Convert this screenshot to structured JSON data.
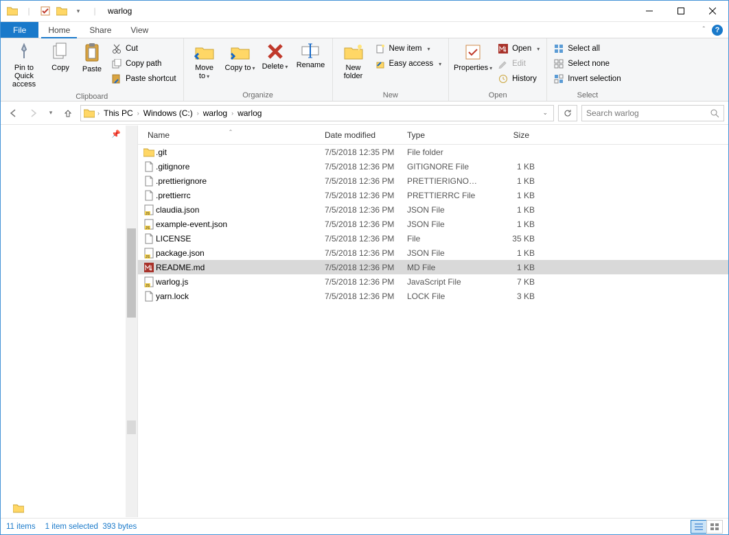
{
  "window": {
    "title": "warlog"
  },
  "tabs": {
    "file": "File",
    "home": "Home",
    "share": "Share",
    "view": "View"
  },
  "ribbon": {
    "clipboard": {
      "label": "Clipboard",
      "pin": "Pin to Quick access",
      "copy": "Copy",
      "paste": "Paste",
      "cut": "Cut",
      "copy_path": "Copy path",
      "paste_shortcut": "Paste shortcut"
    },
    "organize": {
      "label": "Organize",
      "move_to": "Move to",
      "copy_to": "Copy to",
      "delete": "Delete",
      "rename": "Rename"
    },
    "new": {
      "label": "New",
      "new_folder": "New folder",
      "new_item": "New item",
      "easy_access": "Easy access"
    },
    "open": {
      "label": "Open",
      "properties": "Properties",
      "open": "Open",
      "edit": "Edit",
      "history": "History"
    },
    "select": {
      "label": "Select",
      "select_all": "Select all",
      "select_none": "Select none",
      "invert": "Invert selection"
    }
  },
  "breadcrumb": [
    "This PC",
    "Windows (C:)",
    "warlog",
    "warlog"
  ],
  "search": {
    "placeholder": "Search warlog"
  },
  "columns": {
    "name": "Name",
    "date": "Date modified",
    "type": "Type",
    "size": "Size"
  },
  "files": [
    {
      "icon": "folder",
      "name": ".git",
      "date": "7/5/2018 12:35 PM",
      "type": "File folder",
      "size": "",
      "selected": false
    },
    {
      "icon": "file",
      "name": ".gitignore",
      "date": "7/5/2018 12:36 PM",
      "type": "GITIGNORE File",
      "size": "1 KB",
      "selected": false
    },
    {
      "icon": "file",
      "name": ".prettierignore",
      "date": "7/5/2018 12:36 PM",
      "type": "PRETTIERIGNORE ...",
      "size": "1 KB",
      "selected": false
    },
    {
      "icon": "file",
      "name": ".prettierrc",
      "date": "7/5/2018 12:36 PM",
      "type": "PRETTIERRC File",
      "size": "1 KB",
      "selected": false
    },
    {
      "icon": "js",
      "name": "claudia.json",
      "date": "7/5/2018 12:36 PM",
      "type": "JSON File",
      "size": "1 KB",
      "selected": false
    },
    {
      "icon": "js",
      "name": "example-event.json",
      "date": "7/5/2018 12:36 PM",
      "type": "JSON File",
      "size": "1 KB",
      "selected": false
    },
    {
      "icon": "file",
      "name": "LICENSE",
      "date": "7/5/2018 12:36 PM",
      "type": "File",
      "size": "35 KB",
      "selected": false
    },
    {
      "icon": "js",
      "name": "package.json",
      "date": "7/5/2018 12:36 PM",
      "type": "JSON File",
      "size": "1 KB",
      "selected": false
    },
    {
      "icon": "md",
      "name": "README.md",
      "date": "7/5/2018 12:36 PM",
      "type": "MD File",
      "size": "1 KB",
      "selected": true
    },
    {
      "icon": "js",
      "name": "warlog.js",
      "date": "7/5/2018 12:36 PM",
      "type": "JavaScript File",
      "size": "7 KB",
      "selected": false
    },
    {
      "icon": "file",
      "name": "yarn.lock",
      "date": "7/5/2018 12:36 PM",
      "type": "LOCK File",
      "size": "3 KB",
      "selected": false
    }
  ],
  "status": {
    "count": "11 items",
    "selected": "1 item selected",
    "bytes": "393 bytes"
  }
}
